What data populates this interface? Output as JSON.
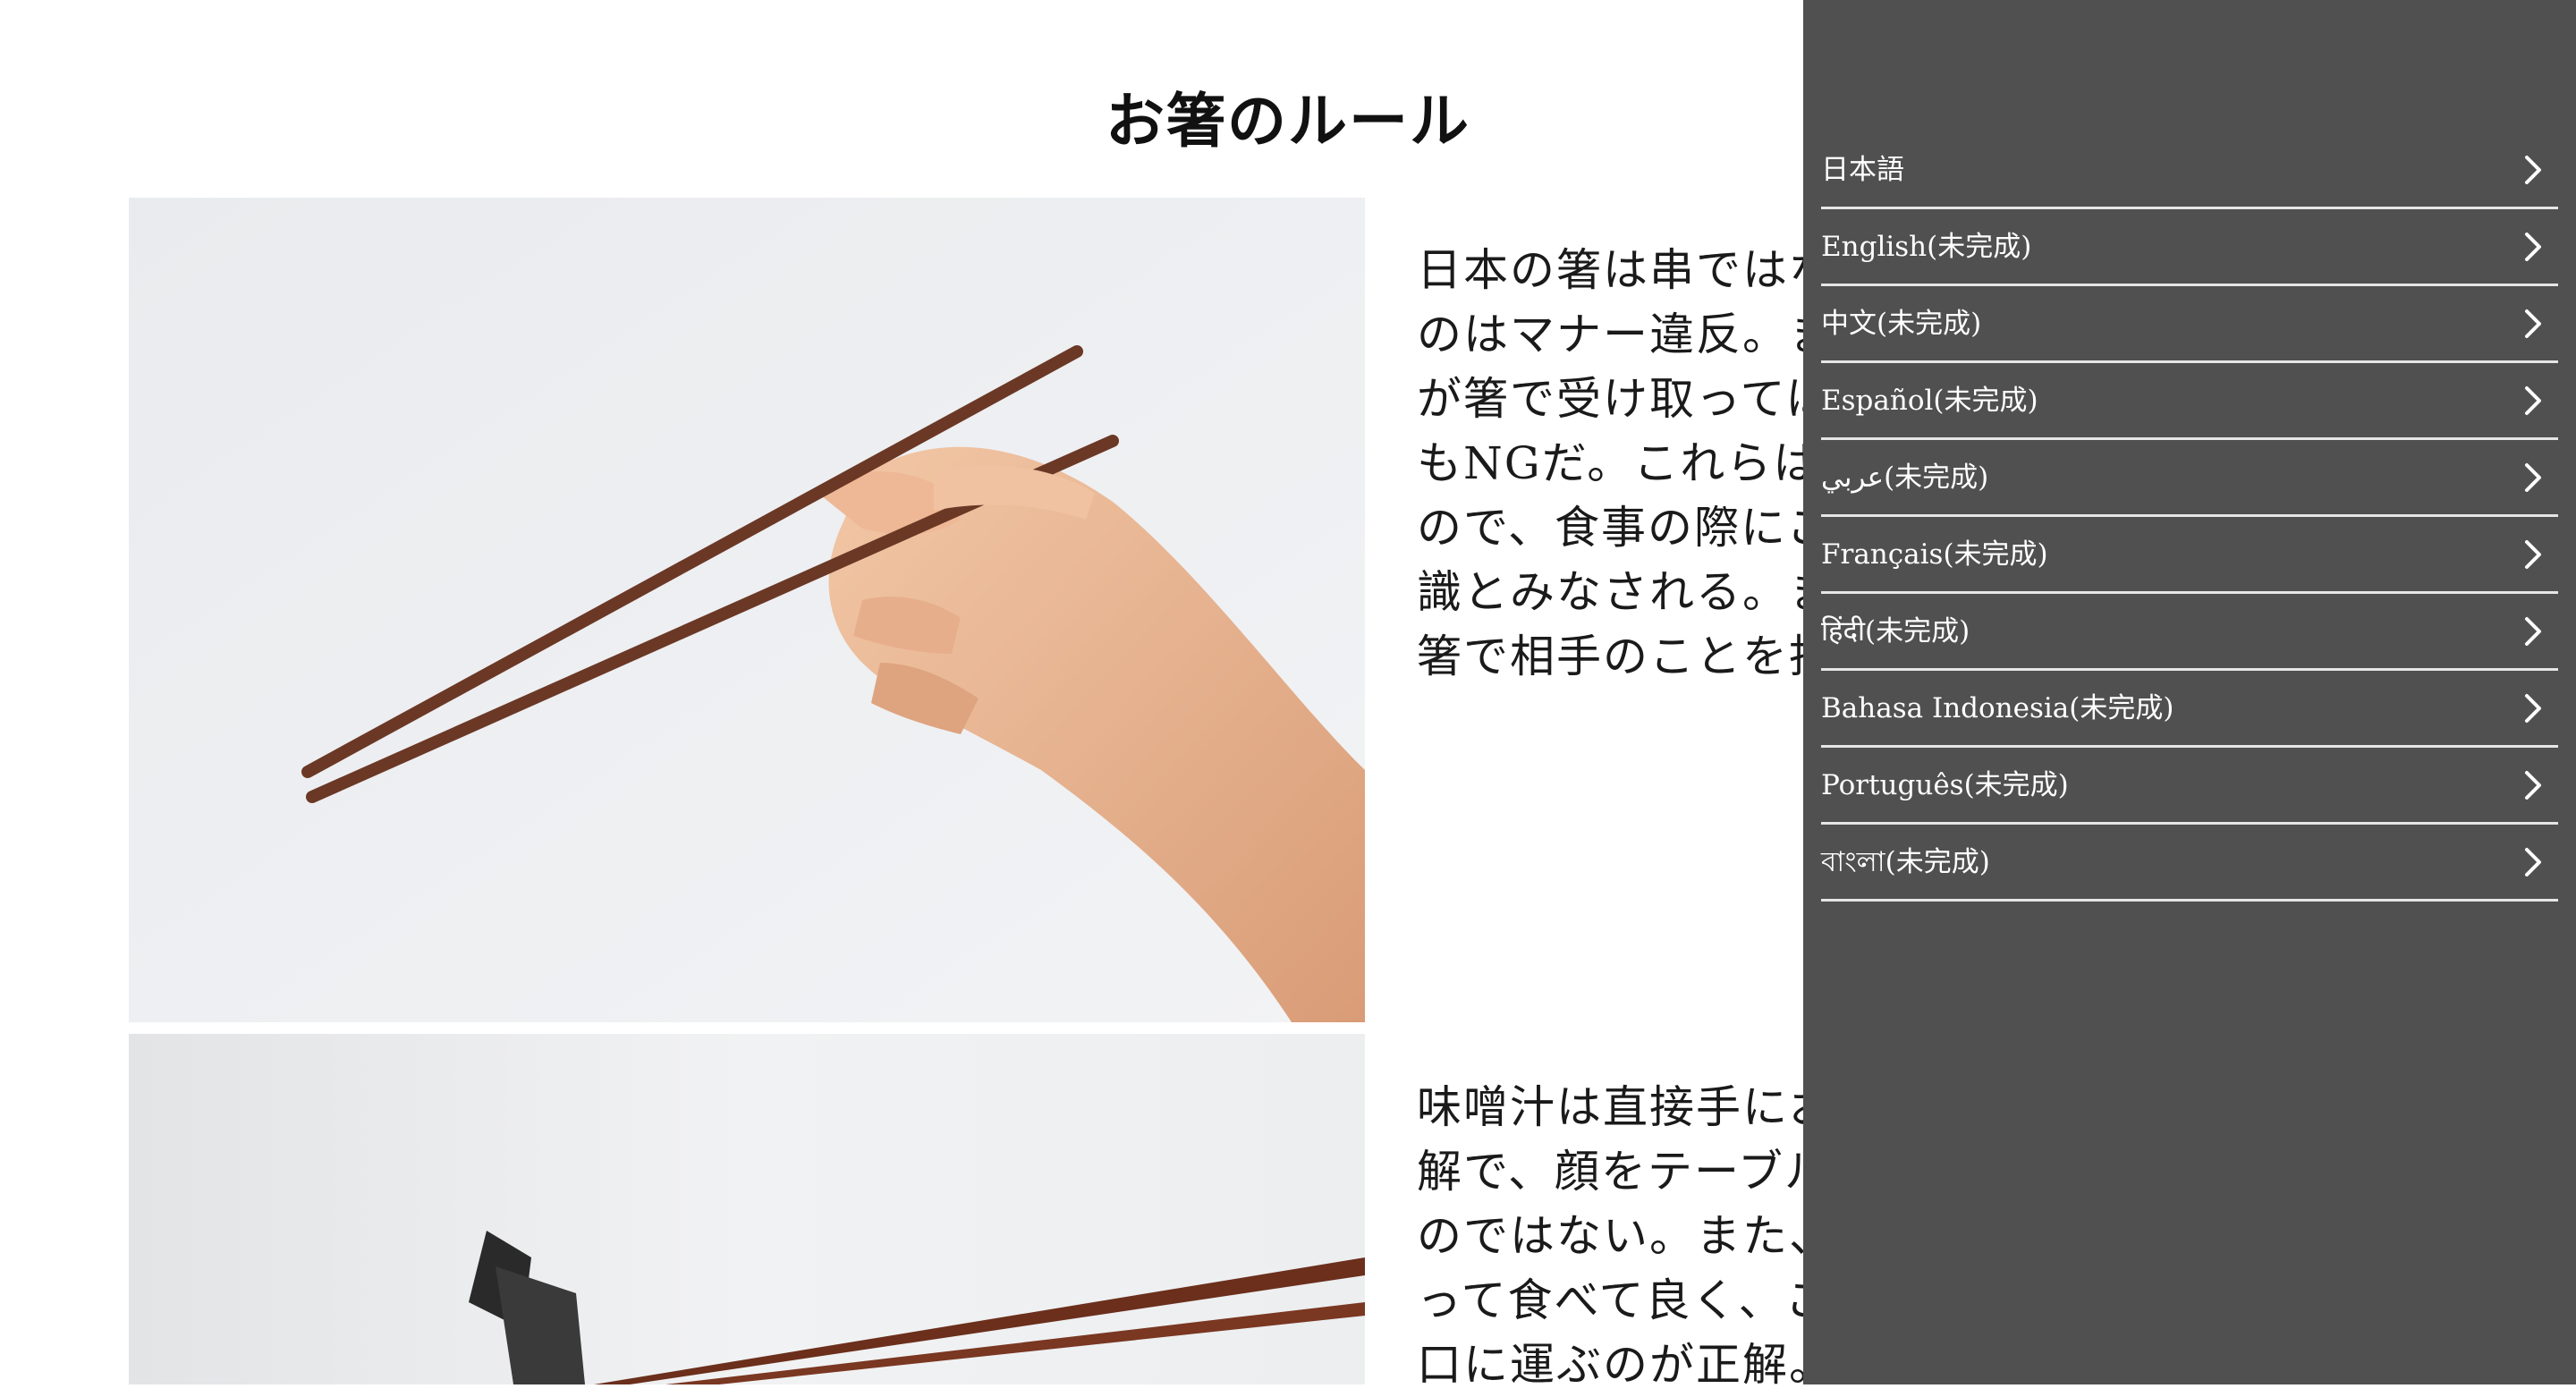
{
  "page": {
    "title": "お箸のルール",
    "sections": [
      {
        "image": "hand-holding-chopsticks-photo",
        "lines": [
          "日本の箸は串ではな",
          "のはマナー違反。ま",
          "が箸で受け取っては",
          "もNGだ。これらは葬",
          "ので、食事の際にこ",
          "識とみなされる。ま",
          "箸で相手のことを指"
        ]
      },
      {
        "image": "chopsticks-on-rest-photo",
        "lines": [
          "味噌汁は直接手にお",
          "解で、顔をテーブル",
          "のではない。また、",
          "って食べて良く、こ",
          "口に運ぶのが正解。"
        ]
      }
    ]
  },
  "menu": {
    "close_icon": "close-icon",
    "item_icon": "chevron-right-icon",
    "background": "#505050",
    "languages": [
      "日本語",
      "English(未完成)",
      "中文(未完成)",
      "Español(未完成)",
      "عربي(未完成)",
      "Français(未完成)",
      "हिंदी(未完成)",
      "Bahasa Indonesia(未完成)",
      "Português(未完成)",
      "বাংলা(未完成)"
    ]
  }
}
